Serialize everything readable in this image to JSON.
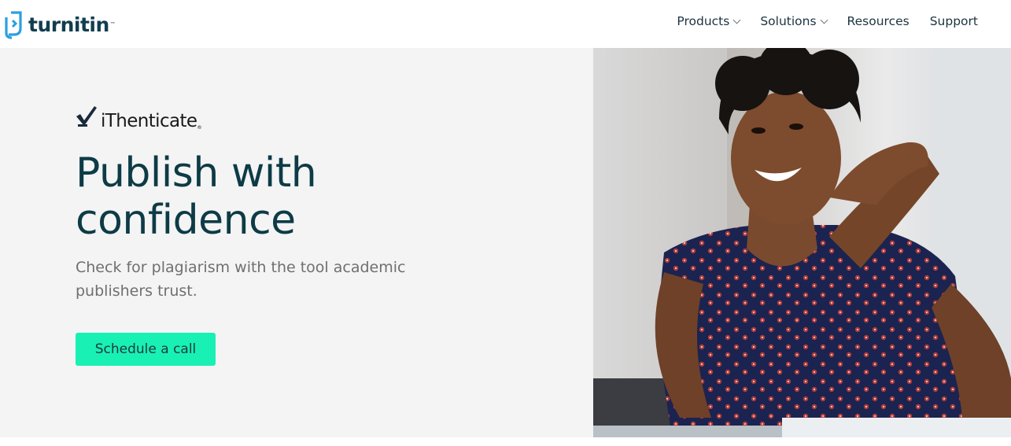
{
  "header": {
    "logo_text": "turnitin",
    "logo_icon": "turnitin-logo-icon",
    "nav": [
      {
        "label": "Products",
        "has_dropdown": true
      },
      {
        "label": "Solutions",
        "has_dropdown": true
      },
      {
        "label": "Resources",
        "has_dropdown": false
      },
      {
        "label": "Support",
        "has_dropdown": false
      }
    ]
  },
  "hero": {
    "product_logo_text": "iThenticate",
    "product_logo_icon": "checkmark-icon",
    "headline_line1": "Publish with",
    "headline_line2": "confidence",
    "subtext_line1": "Check for plagiarism with the tool academic",
    "subtext_line2": "publishers trust.",
    "cta_label": "Schedule a call",
    "image_alt": "Smiling woman with clasped hands sitting at a desk"
  },
  "colors": {
    "brand_dark": "#123d50",
    "headline": "#0d3b46",
    "cta_bg": "#19f0b4",
    "hero_bg": "#f4f4f4",
    "logo_blue": "#2b9fe0"
  }
}
